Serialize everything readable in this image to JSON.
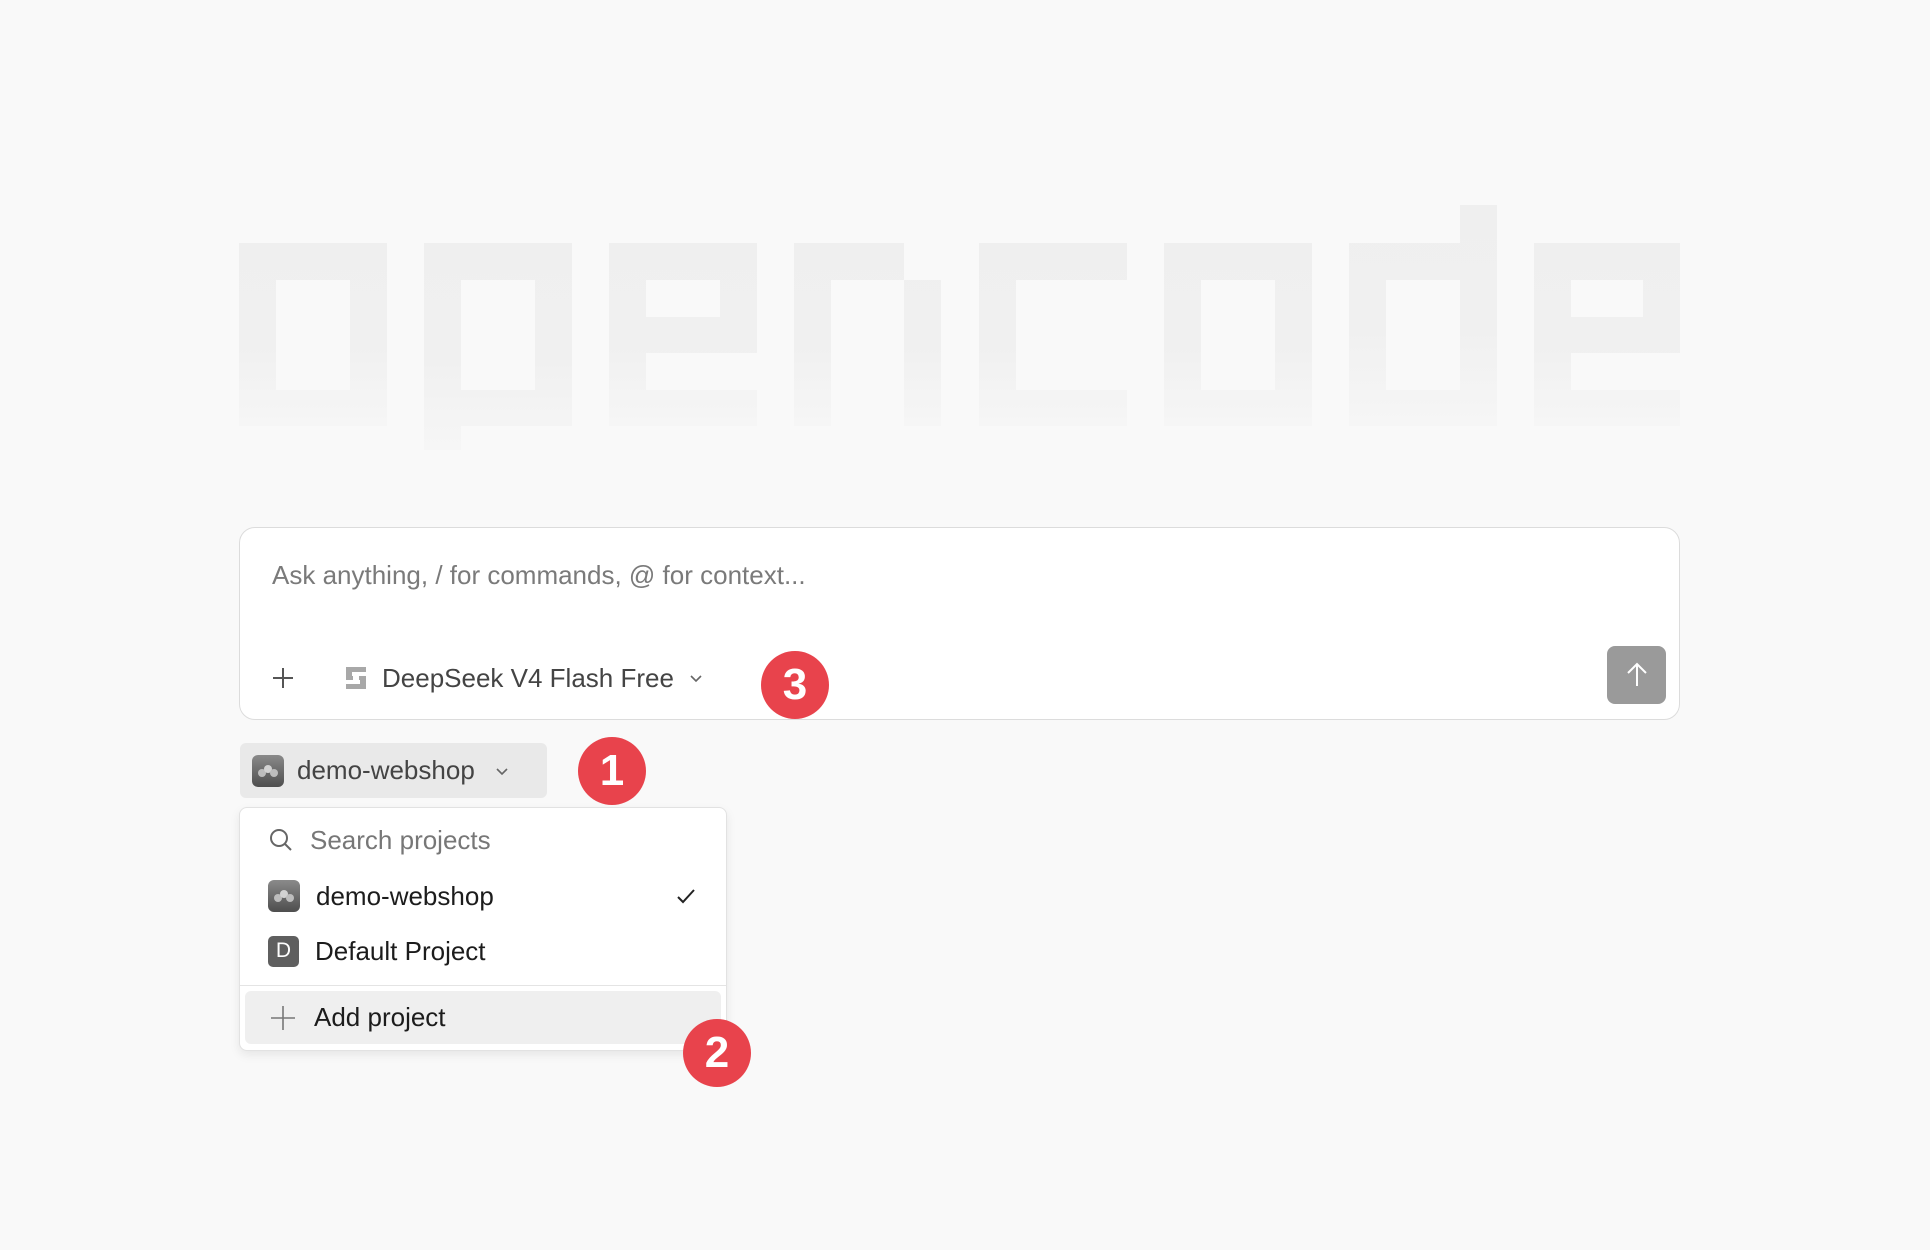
{
  "logo": {
    "text": "opencode"
  },
  "composer": {
    "placeholder": "Ask anything, / for commands, @ for context...",
    "model_label": "DeepSeek V4 Flash Free",
    "add_icon": "plus-icon",
    "send_icon": "arrow-up-icon"
  },
  "project_selector": {
    "label": "demo-webshop"
  },
  "dropdown": {
    "search_placeholder": "Search projects",
    "projects": [
      {
        "label": "demo-webshop",
        "selected": true
      },
      {
        "label": "Default Project",
        "initial": "D",
        "selected": false
      }
    ],
    "add_label": "Add project"
  },
  "annotations": [
    "1",
    "2",
    "3"
  ],
  "colors": {
    "background": "#f9f9f9",
    "badge": "#e8434c",
    "send_button": "#9a9a9a"
  }
}
